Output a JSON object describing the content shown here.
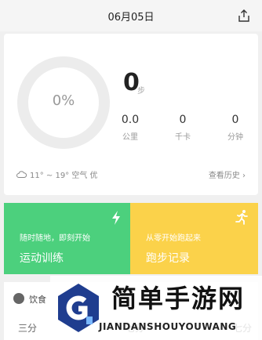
{
  "header": {
    "date": "06月05日",
    "share_icon": "share-icon"
  },
  "steps": {
    "percent_label": "0%",
    "progress": 0,
    "count": "0",
    "unit": "步",
    "stats": [
      {
        "value": "0.0",
        "label": "公里"
      },
      {
        "value": "0",
        "label": "千卡"
      },
      {
        "value": "0",
        "label": "分钟"
      }
    ],
    "weather": "11° ~ 19° 空气 优",
    "history_link": "查看历史 ›"
  },
  "actions": {
    "training": {
      "subtitle": "随时随地，即刻开始",
      "title": "运动训练",
      "color": "#4cd07d"
    },
    "running": {
      "subtitle": "从零开始跑起来",
      "title": "跑步记录",
      "color": "#fbd24a"
    }
  },
  "diet": {
    "title": "饮食",
    "meals": [
      "三分",
      "七分",
      "七分"
    ]
  },
  "watermark": {
    "title": "简单手游网",
    "subtitle": "JIANDANSHOUYOUWANG"
  }
}
